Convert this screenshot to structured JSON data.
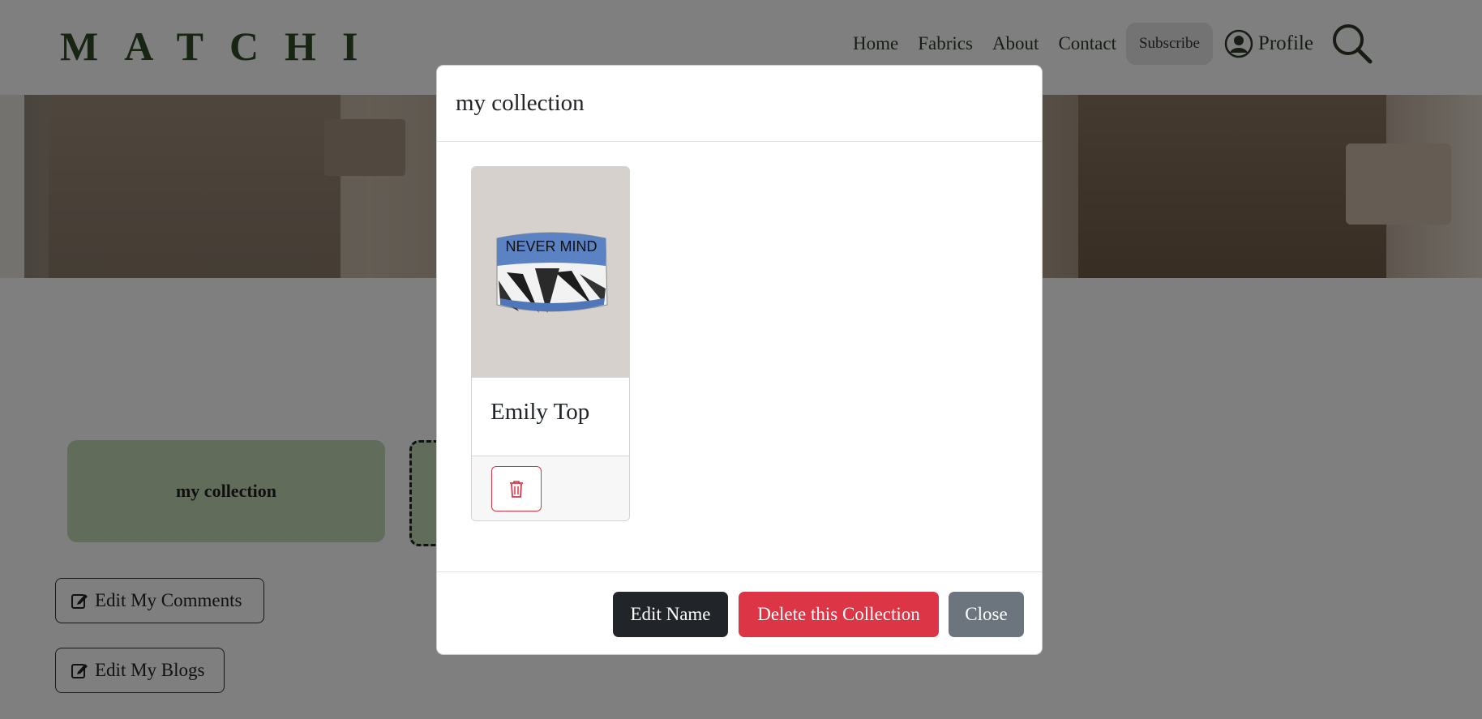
{
  "nav": {
    "brand": "MATCHI",
    "links": [
      "Home",
      "Fabrics",
      "About",
      "Contact"
    ],
    "subscribe_label": "Subscribe",
    "profile_label": "Profile"
  },
  "page": {
    "collection_name": "my collection",
    "edit_comments_label": "Edit My Comments",
    "edit_blogs_label": "Edit My Blogs"
  },
  "modal": {
    "title": "my collection",
    "items": [
      {
        "name": "Emily Top",
        "image_text": "NEVER MIND"
      }
    ],
    "buttons": {
      "edit_name": "Edit Name",
      "delete": "Delete this Collection",
      "close": "Close"
    }
  },
  "colors": {
    "brand": "#2f4a24",
    "collection_card": "#c3d9b6",
    "danger": "#dc3545",
    "dark": "#212529",
    "secondary": "#6c757d"
  }
}
